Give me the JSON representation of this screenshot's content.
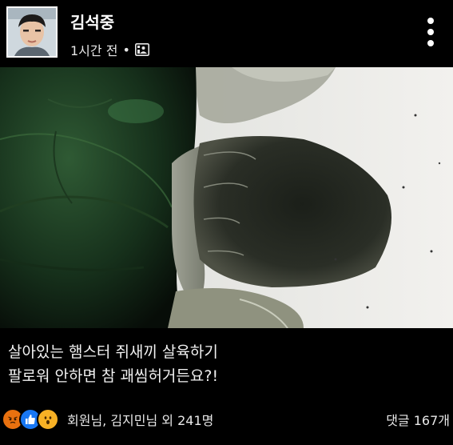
{
  "post": {
    "author": "김석중",
    "time": "1시간 전",
    "separator": "•",
    "caption_line1": "살아있는 햄스터 쥐새끼 살육하기",
    "caption_line2": "팔로워 안하면 참 괘씸허거든요?!"
  },
  "reactions": {
    "summary": "회원님, 김지민님 외 241명",
    "comments": "댓글 167개",
    "icons": [
      "angry-icon",
      "like-icon",
      "wow-icon"
    ]
  },
  "colors": {
    "background": "#000000",
    "like": "#1877f2",
    "angry": "#e9710f",
    "wow": "#f7b125"
  }
}
